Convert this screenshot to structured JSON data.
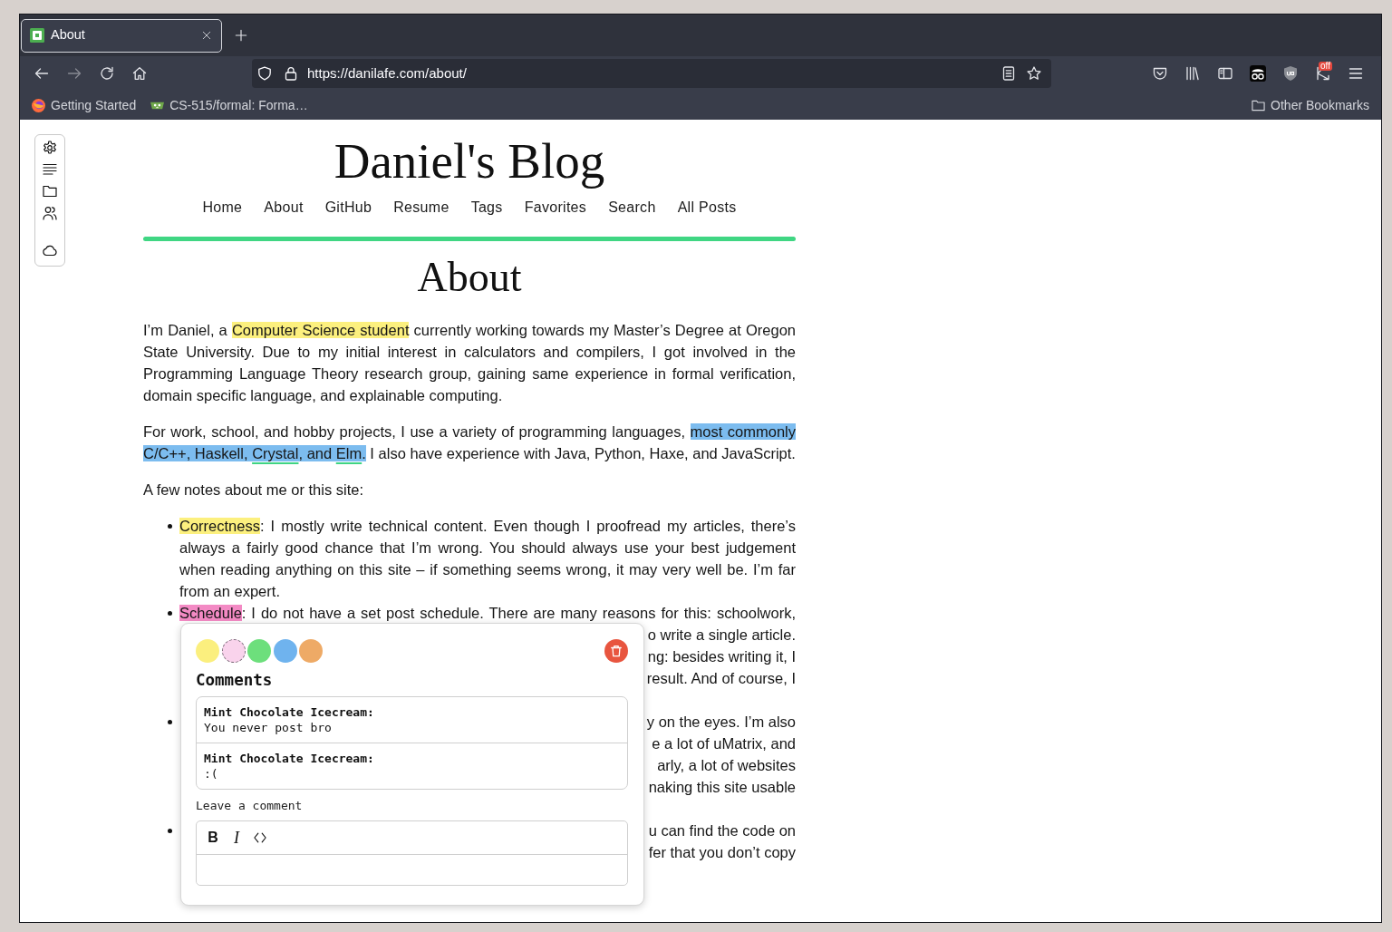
{
  "browser": {
    "tabs": [
      {
        "title": "About",
        "selected": true
      }
    ],
    "forward_disabled": true,
    "url": "https://danilafe.com/about/",
    "extension_badge": "off",
    "bookmarks": [
      {
        "kind": "browser",
        "label": "Getting Started"
      },
      {
        "kind": "project",
        "label": "CS-515/formal: Forma…"
      }
    ],
    "other_bookmarks": "Other Bookmarks"
  },
  "blog": {
    "title": "Daniel's Blog",
    "nav": [
      "Home",
      "About",
      "GitHub",
      "Resume",
      "Tags",
      "Favorites",
      "Search",
      "All Posts"
    ]
  },
  "article": {
    "title": "About",
    "paragraphs": [
      {
        "segments": [
          {
            "kind": "text",
            "text": "I’m Daniel, a "
          },
          {
            "kind": "text",
            "text": "Computer Science student",
            "color": "#fcf07e"
          },
          {
            "kind": "text",
            "text": " currently working towards my Master’s Degree at Oregon State University. Due to my initial interest in calculators and compilers, I got involved in the Programming Language Theory research group, gaining same experience in formal verification, domain specific language, and explainable computing."
          }
        ]
      },
      {
        "segments": [
          {
            "kind": "text",
            "text": "For work, school, and hobby projects, I use a variety of programming languages, "
          },
          {
            "kind": "text",
            "text": "most commonly C/C++, Haskell, ",
            "color": "#7cbcef"
          },
          {
            "kind": "link",
            "text": "Crystal",
            "color": "#7cbcef"
          },
          {
            "kind": "text",
            "text": ", and ",
            "color": "#7cbcef"
          },
          {
            "kind": "link",
            "text": "Elm",
            "color": "#7cbcef"
          },
          {
            "kind": "text",
            "text": ".",
            "color": "#7cbcef"
          },
          {
            "kind": "text",
            "text": " I also have experience with Java, Python, Haxe, and JavaScript."
          }
        ]
      },
      {
        "segments": [
          {
            "kind": "text",
            "text": "A few notes about me or this site:"
          }
        ]
      }
    ],
    "notes": [
      {
        "segments": [
          {
            "kind": "text",
            "text": "Correctness",
            "color": "#fcf07e"
          },
          {
            "kind": "text",
            "text": ": I mostly write technical content. Even though I proofread my articles, there’s always a fairly good chance that I’m wrong. You should always use your best judgement when reading anything on this site – if something seems wrong, it may very well be. I’m far from an expert."
          }
        ]
      },
      {
        "segments": [
          {
            "kind": "text",
            "text": "Schedule",
            "color": "#f38ac4"
          },
          {
            "kind": "text",
            "text": ": I do not have a set post schedule. There are many reasons for this: schoolwork,"
          }
        ],
        "fragments": [
          "o write a single article.",
          "ng: besides writing it, I",
          "result. And of course, I"
        ],
        "comment_popup": {
          "colors": [
            {
              "color": "#fbef7e",
              "selected": false
            },
            {
              "color": "#f9d3ec",
              "selected": true
            },
            {
              "color": "#6ddf7c",
              "selected": false
            },
            {
              "color": "#6fb3ee",
              "selected": false
            },
            {
              "color": "#eeaa66",
              "selected": false
            }
          ],
          "heading": "Comments",
          "comments": [
            {
              "author": "Mint Chocolate Icecream:",
              "text": "You never post bro"
            },
            {
              "author": "Mint Chocolate Icecream:",
              "text": ":("
            }
          ],
          "label": "Leave a comment",
          "toolbar": [
            {
              "kind": "bold",
              "label": "B"
            },
            {
              "kind": "italic",
              "label": "I"
            },
            {
              "kind": "code"
            }
          ]
        }
      },
      {
        "fragments": [
          "y on the eyes. I’m also",
          "e a lot of uMatrix, and",
          "arly, a lot of websites",
          "naking this site usable"
        ]
      },
      {
        "fragments": [
          "u can find the code on",
          "fer that you don’t copy"
        ]
      }
    ]
  }
}
